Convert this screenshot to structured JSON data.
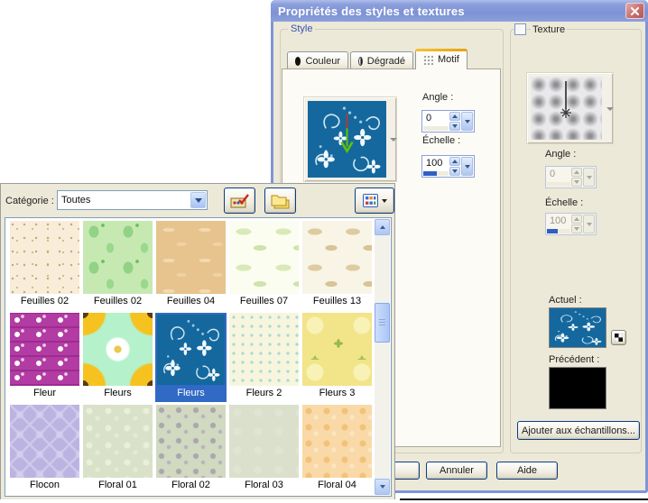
{
  "window": {
    "title": "Propriétés des styles et textures"
  },
  "style_group": {
    "label": "Style",
    "tabs": [
      {
        "label": "Couleur",
        "icon": "color-circle-icon"
      },
      {
        "label": "Dégradé",
        "icon": "gradient-circle-icon"
      },
      {
        "label": "Motif",
        "icon": "pattern-grid-icon"
      }
    ],
    "active_tab": "Motif",
    "angle_label": "Angle :",
    "angle_value": "0",
    "scale_label": "Échelle :",
    "scale_value": "100"
  },
  "texture_group": {
    "label": "Texture",
    "checkbox_checked": false,
    "angle_label": "Angle :",
    "angle_value": "0",
    "scale_label": "Échelle :",
    "scale_value": "100",
    "current_label": "Actuel :",
    "previous_label": "Précédent :",
    "add_swatch_button": "Ajouter aux échantillons..."
  },
  "footer_buttons": {
    "cancel": "Annuler",
    "help": "Aide"
  },
  "pattern_picker": {
    "category_label": "Catégorie :",
    "category_value": "Toutes",
    "selected_swatch": "Fleurs",
    "swatches": [
      {
        "label": "Feuilles 02",
        "base_color": "#F9ECD9"
      },
      {
        "label": "Feuilles 02",
        "base_color": "#C6E9B2"
      },
      {
        "label": "Feuilles 04",
        "base_color": "#E7C38E"
      },
      {
        "label": "Feuilles 07",
        "base_color": "#FBFDF1"
      },
      {
        "label": "Feuilles 13",
        "base_color": "#F8F4E6"
      },
      {
        "label": "Fleur",
        "base_color": "#B23CA4"
      },
      {
        "label": "Fleurs",
        "base_color": "#B5F1CB"
      },
      {
        "label": "Fleurs",
        "base_color": "#15689E",
        "selected": true
      },
      {
        "label": "Fleurs 2",
        "base_color": "#F7F5DE"
      },
      {
        "label": "Fleurs 3",
        "base_color": "#F2E488"
      },
      {
        "label": "Flocon",
        "base_color": "#BBB4E1"
      },
      {
        "label": "Floral 01",
        "base_color": "#D9E1C8"
      },
      {
        "label": "Floral 02",
        "base_color": "#D2D9C1"
      },
      {
        "label": "Floral 03",
        "base_color": "#DAE0CC"
      },
      {
        "label": "Floral 04",
        "base_color": "#F9D9A7"
      }
    ]
  },
  "colors": {
    "selection_blue": "#316AC5",
    "titlebar_blue": "#7D92D4",
    "dialog_bg": "#ECE9D8",
    "active_tab_accent": "#E9A10E",
    "slider_fill_blue": "#2F5FC4",
    "pattern_blue": "#15689E"
  }
}
